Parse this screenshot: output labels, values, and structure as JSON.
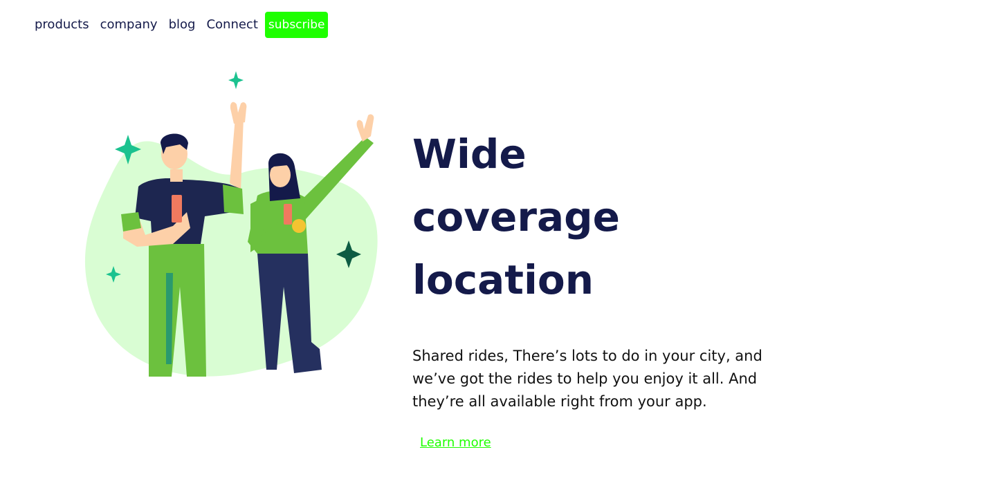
{
  "nav": {
    "items": [
      {
        "label": "products"
      },
      {
        "label": "company"
      },
      {
        "label": "blog"
      },
      {
        "label": "Connect"
      }
    ],
    "subscribe_label": "subscribe"
  },
  "hero": {
    "title": "Wide coverage location",
    "description": "Shared rides, There’s lots to do in your city, and we’ve got the rides to help you enjoy it all. And they’re all available right from your app.",
    "link_label": "Learn more"
  },
  "colors": {
    "navy": "#141a4a",
    "accent_green": "#1eff00",
    "blob": "#d9fdd3",
    "shirt_green": "#6cc13e",
    "sparkle": "#1bc28f"
  }
}
